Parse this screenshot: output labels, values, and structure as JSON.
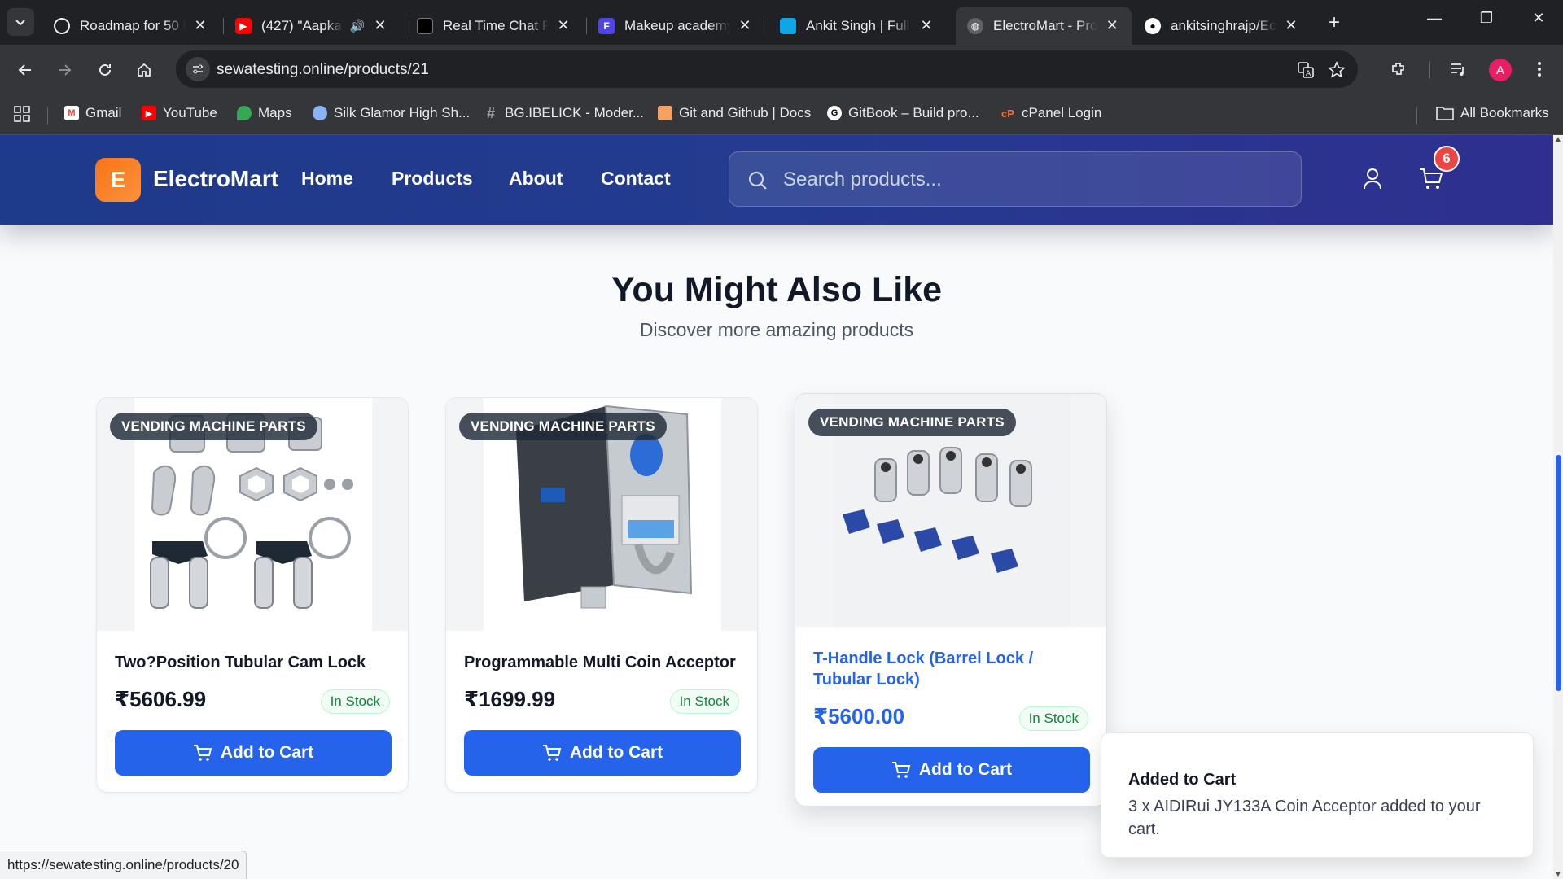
{
  "browser": {
    "tabs": [
      {
        "title": "Roadmap for 50 l",
        "icon": "openai-icon",
        "active": false
      },
      {
        "title": "(427) \"Aapka",
        "icon": "youtube-icon",
        "active": false,
        "audio": true
      },
      {
        "title": "Real Time Chat Pl",
        "icon": "chat-app-icon",
        "active": false
      },
      {
        "title": "Makeup academy",
        "icon": "forms-icon",
        "active": false
      },
      {
        "title": "Ankit Singh | Full",
        "icon": "portfolio-icon",
        "active": false
      },
      {
        "title": "ElectroMart - Pro",
        "icon": "globe-icon",
        "active": true
      },
      {
        "title": "ankitsinghrajp/Ec",
        "icon": "github-icon",
        "active": false
      }
    ],
    "url": "sewatesting.online/products/21",
    "profile_initial": "A",
    "bookmarks": [
      {
        "label": "Gmail",
        "icon": "gmail-icon"
      },
      {
        "label": "YouTube",
        "icon": "youtube-icon"
      },
      {
        "label": "Maps",
        "icon": "maps-icon"
      },
      {
        "label": "Silk Glamor High Sh...",
        "icon": "silk-icon"
      },
      {
        "label": "BG.IBELICK - Moder...",
        "icon": "hash-icon"
      },
      {
        "label": "Git and Github | Docs",
        "icon": "git-icon"
      },
      {
        "label": "GitBook – Build pro...",
        "icon": "gitbook-icon"
      },
      {
        "label": "cPanel Login",
        "icon": "cpanel-icon"
      }
    ],
    "all_bookmarks_label": "All Bookmarks",
    "status_url": "https://sewatesting.online/products/20"
  },
  "site": {
    "logo_letter": "E",
    "name": "ElectroMart",
    "nav": [
      "Home",
      "Products",
      "About",
      "Contact"
    ],
    "search_placeholder": "Search products...",
    "cart_count": "6",
    "colors": {
      "primary": "#2563eb",
      "header": "#1e3a8a",
      "logo": "#f97316",
      "badge": "#ef4444"
    }
  },
  "section": {
    "title": "You Might Also Like",
    "subtitle": "Discover more amazing products"
  },
  "products": [
    {
      "category": "VENDING MACHINE PARTS",
      "name": "Two?Position Tubular Cam Lock",
      "price": "₹5606.99",
      "stock": "In Stock",
      "button": "Add to Cart",
      "image": "tubular-cam-lock-image"
    },
    {
      "category": "VENDING MACHINE PARTS",
      "name": "Programmable Multi Coin Acceptor",
      "price": "₹1699.99",
      "stock": "In Stock",
      "button": "Add to Cart",
      "image": "coin-acceptor-image"
    },
    {
      "category": "VENDING MACHINE PARTS",
      "name": "T-Handle Lock (Barrel Lock / Tubular Lock)",
      "price": "₹5600.00",
      "stock": "In Stock",
      "button": "Add to Cart",
      "image": "barrel-locks-image"
    }
  ],
  "toast": {
    "title": "Added to Cart",
    "message": "3 x AIDIRui JY133A Coin Acceptor added to your cart."
  }
}
